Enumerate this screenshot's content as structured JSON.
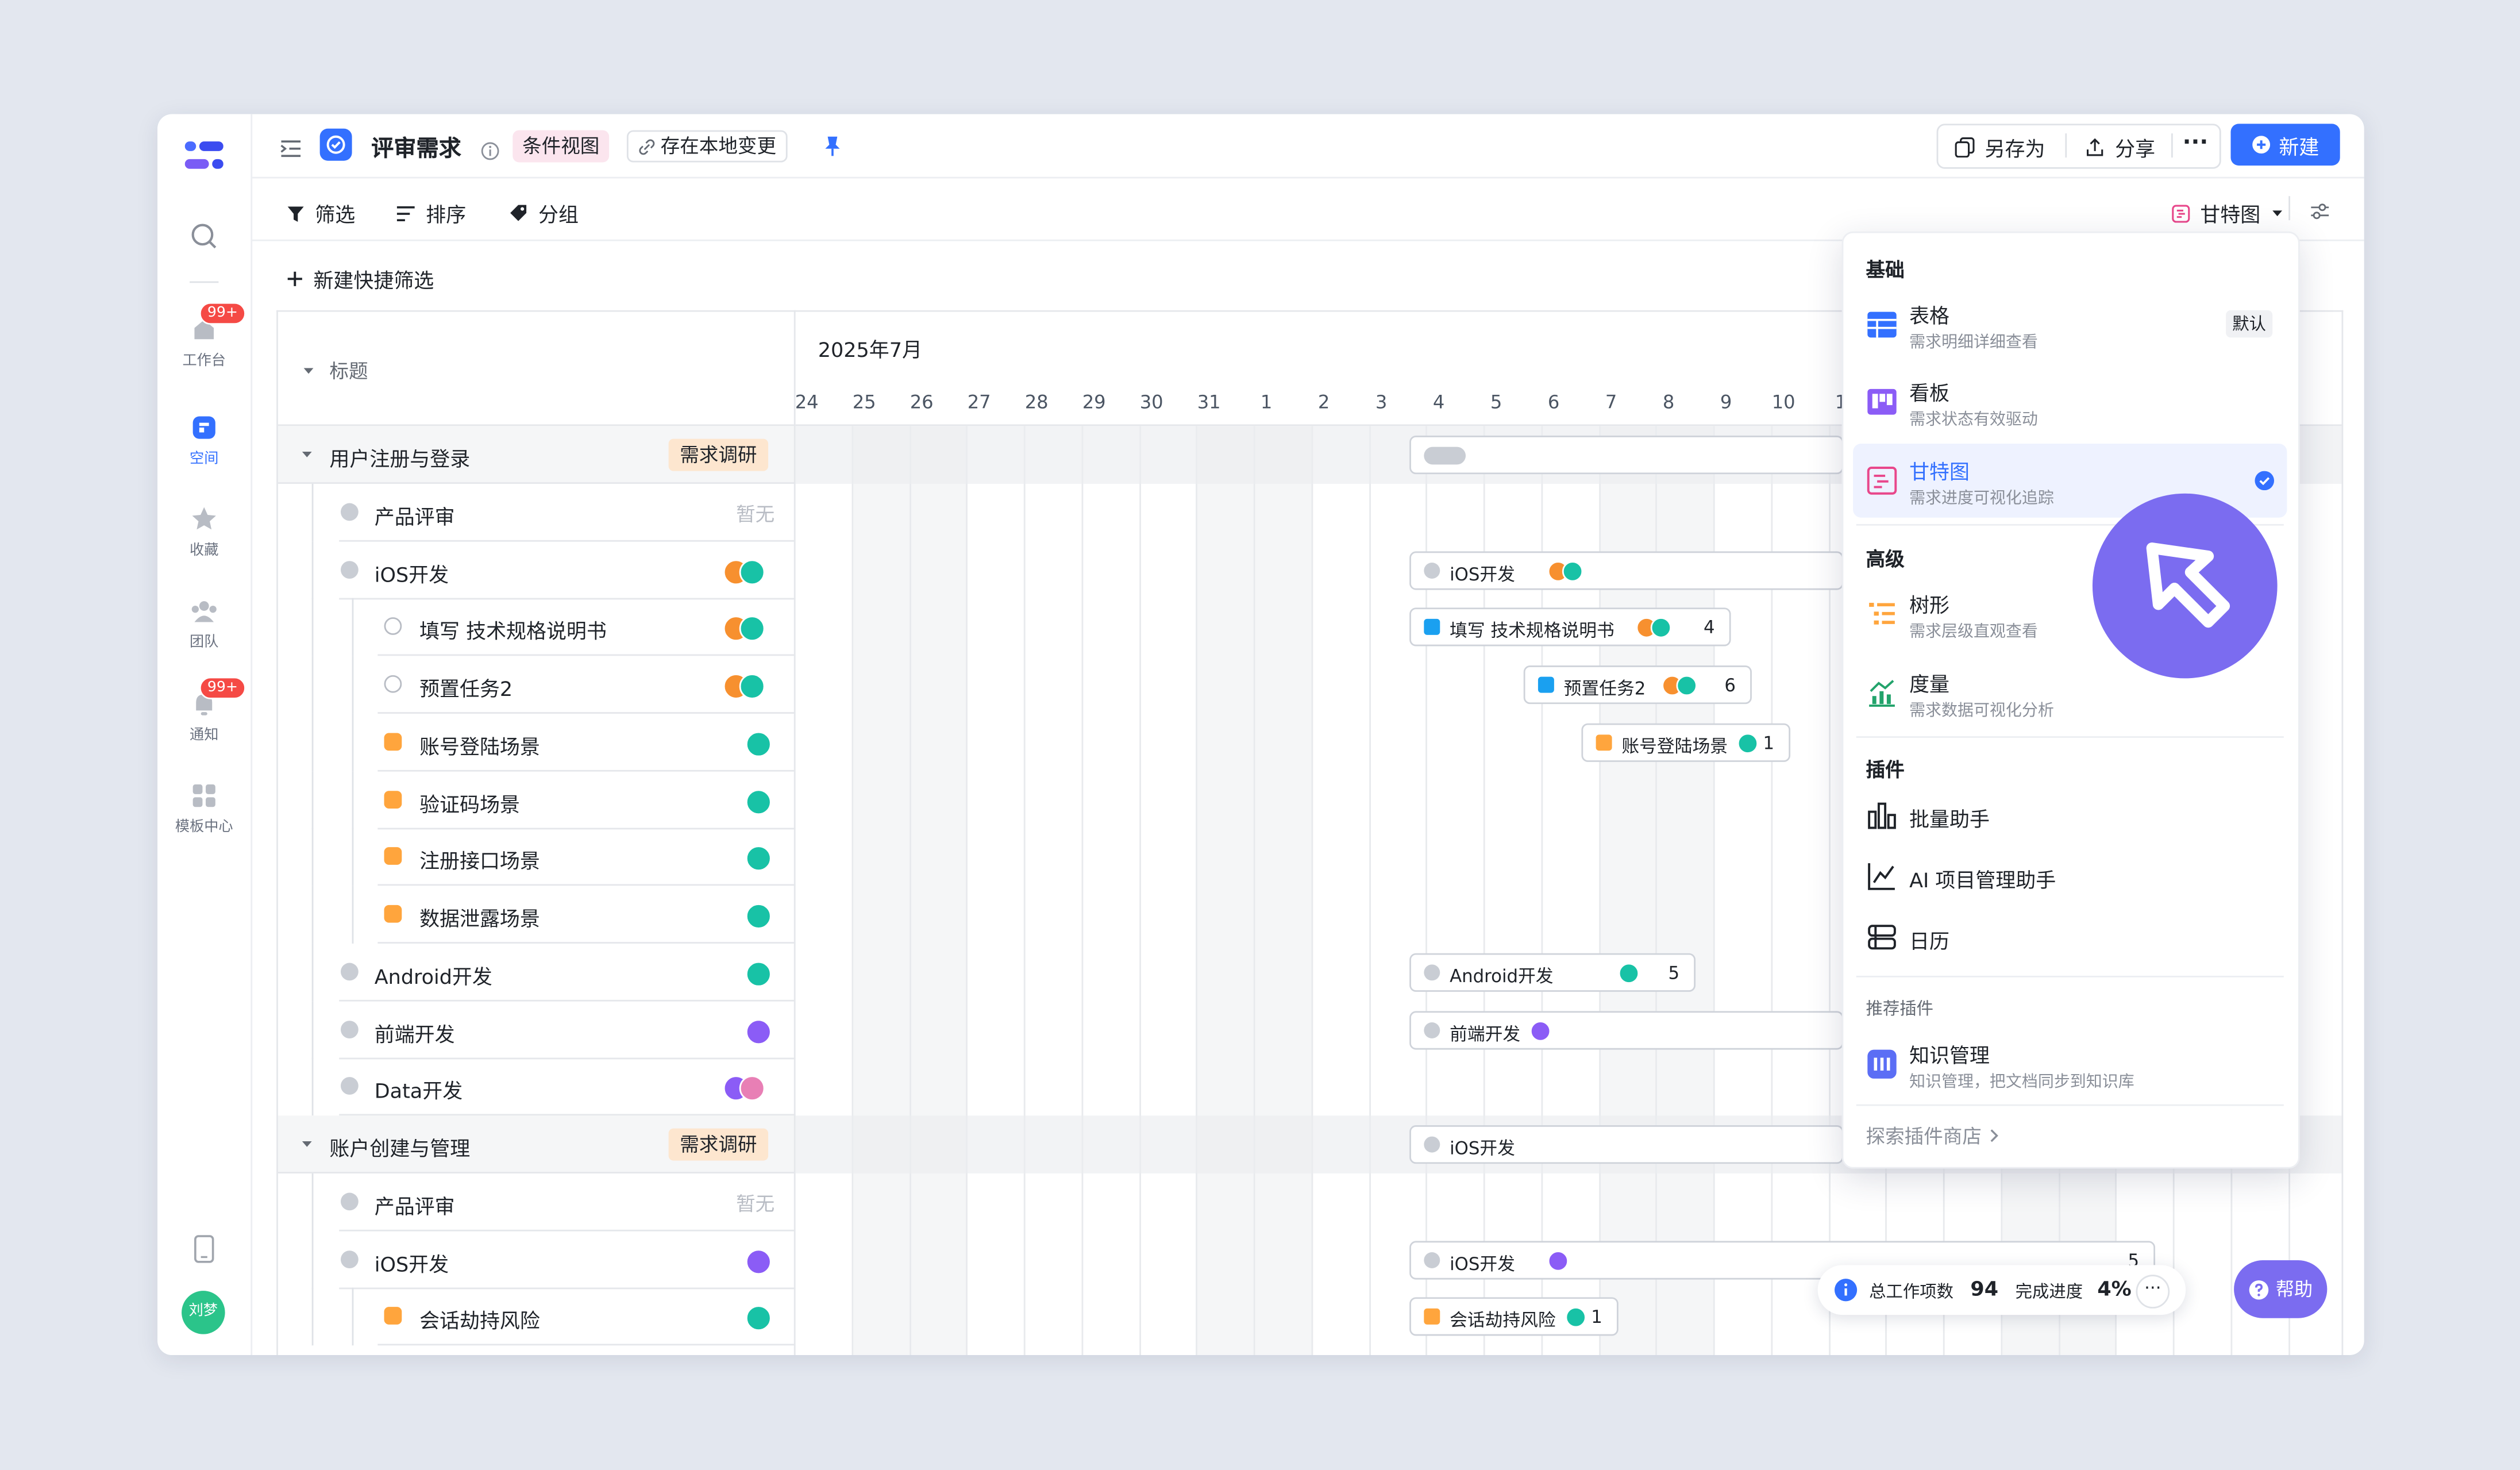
{
  "app": {
    "title": "评审需求",
    "view_tag": "条件视图",
    "local_changes": "存在本地变更"
  },
  "nav": {
    "items": [
      {
        "label": "工作台",
        "badge": "99+"
      },
      {
        "label": "空间"
      },
      {
        "label": "收藏"
      },
      {
        "label": "团队"
      },
      {
        "label": "通知",
        "badge": "99+"
      },
      {
        "label": "模板中心"
      }
    ],
    "user": "刘梦"
  },
  "header": {
    "save_as": "另存为",
    "share": "分享",
    "new": "新建"
  },
  "toolbar": {
    "filter": "筛选",
    "sort": "排序",
    "group": "分组",
    "view": "甘特图"
  },
  "quick_filter": "新建快捷筛选",
  "grid": {
    "title_col": "标题",
    "month": "2025年7月",
    "days": [
      "24",
      "25",
      "26",
      "27",
      "28",
      "29",
      "30",
      "31",
      "1",
      "2",
      "3",
      "4",
      "5",
      "6",
      "7",
      "8",
      "9",
      "10",
      "1",
      "",
      "",
      "",
      "",
      "",
      "",
      "",
      "",
      "",
      "",
      "",
      "",
      "",
      "",
      "",
      "",
      "",
      "9"
    ],
    "rows": [
      {
        "kind": "group",
        "label": "用户注册与登录",
        "tag": "需求调研"
      },
      {
        "kind": "task",
        "label": "产品评审",
        "extra": "暂无"
      },
      {
        "kind": "task",
        "label": "iOS开发"
      },
      {
        "kind": "sub",
        "label": "填写 技术规格说明书"
      },
      {
        "kind": "sub",
        "label": "预置任务2"
      },
      {
        "kind": "sub",
        "label": "账号登陆场景"
      },
      {
        "kind": "sub",
        "label": "验证码场景"
      },
      {
        "kind": "sub",
        "label": "注册接口场景"
      },
      {
        "kind": "sub",
        "label": "数据泄露场景"
      },
      {
        "kind": "task",
        "label": "Android开发"
      },
      {
        "kind": "task",
        "label": "前端开发"
      },
      {
        "kind": "task",
        "label": "Data开发"
      },
      {
        "kind": "group",
        "label": "账户创建与管理",
        "tag": "需求调研"
      },
      {
        "kind": "task",
        "label": "产品评审",
        "extra": "暂无"
      },
      {
        "kind": "task",
        "label": "iOS开发"
      },
      {
        "kind": "sub",
        "label": "会话劫持风险"
      }
    ],
    "bars": [
      {
        "label": "iOS开发",
        "count": ""
      },
      {
        "label": "填写 技术规格说明书",
        "count": "4"
      },
      {
        "label": "预置任务2",
        "count": "6"
      },
      {
        "label": "账号登陆场景",
        "count": "1"
      },
      {
        "label": "Android开发",
        "count": "5"
      },
      {
        "label": "前端开发",
        "count": ""
      },
      {
        "label": "iOS开发",
        "count": ""
      },
      {
        "label": "iOS开发",
        "count": "5"
      },
      {
        "label": "会话劫持风险",
        "count": "1"
      }
    ]
  },
  "dropdown": {
    "sec_basic": "基础",
    "table": {
      "title": "表格",
      "desc": "需求明细详细查看",
      "badge": "默认"
    },
    "kanban": {
      "title": "看板",
      "desc": "需求状态有效驱动"
    },
    "gantt": {
      "title": "甘特图",
      "desc": "需求进度可视化追踪"
    },
    "sec_adv": "高级",
    "tree": {
      "title": "树形",
      "desc": "需求层级直观查看"
    },
    "metric": {
      "title": "度量",
      "desc": "需求数据可视化分析"
    },
    "sec_plugin": "插件",
    "batch": "批量助手",
    "ai": "AI 项目管理助手",
    "calendar": "日历",
    "sec_rec": "推荐插件",
    "knowledge": {
      "title": "知识管理",
      "desc": "知识管理，把文档同步到知识库"
    },
    "store": "探索插件商店"
  },
  "footer": {
    "total_label": "总工作项数",
    "total": "94",
    "progress_label": "完成进度",
    "progress": "4%",
    "help": "帮助"
  },
  "colors": {
    "primary": "#3370ff",
    "accent_orange": "#ffa53d",
    "tag_bg": "#fde6cf",
    "bubble": "#7b6cf0"
  }
}
